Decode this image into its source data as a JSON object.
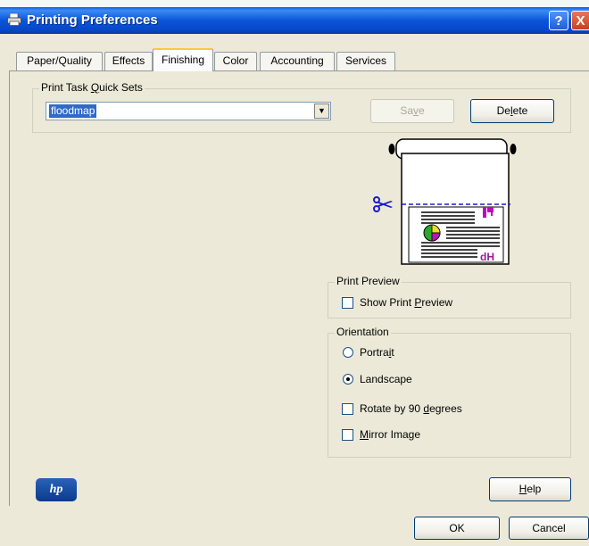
{
  "window": {
    "title": "Printing Preferences"
  },
  "title_buttons": {
    "help": "?",
    "close": "X"
  },
  "tabs": [
    {
      "label": "Paper/Quality",
      "active": false
    },
    {
      "label": "Effects",
      "active": false
    },
    {
      "label": "Finishing",
      "active": true
    },
    {
      "label": "Color",
      "active": false
    },
    {
      "label": "Accounting",
      "active": false
    },
    {
      "label": "Services",
      "active": false
    }
  ],
  "quick_sets": {
    "label_pre": "Print Task ",
    "label_accel": "Q",
    "label_post": "uick Sets",
    "value": "floodmap",
    "save_pre": "Sa",
    "save_accel": "v",
    "save_post": "e",
    "delete_pre": "De",
    "delete_accel": "l",
    "delete_post": "ete"
  },
  "preview_image": {
    "caption": "dH"
  },
  "print_preview": {
    "label": "Print Preview",
    "show_pre": "Show Print ",
    "show_accel": "P",
    "show_post": "review",
    "checked": false
  },
  "orientation": {
    "label": "Orientation",
    "portrait_pre": "Portra",
    "portrait_accel": "i",
    "portrait_post": "t",
    "landscape": "Landscape",
    "rotate_pre": "Rotate by 90 ",
    "rotate_accel": "d",
    "rotate_post": "egrees",
    "mirror_accel": "M",
    "mirror_post": "irror Image",
    "selected": "Landscape",
    "rotate_checked": false,
    "mirror_checked": false
  },
  "footer": {
    "logo": "hp",
    "help_accel": "H",
    "help_post": "elp",
    "ok": "OK",
    "cancel": "Cancel"
  }
}
